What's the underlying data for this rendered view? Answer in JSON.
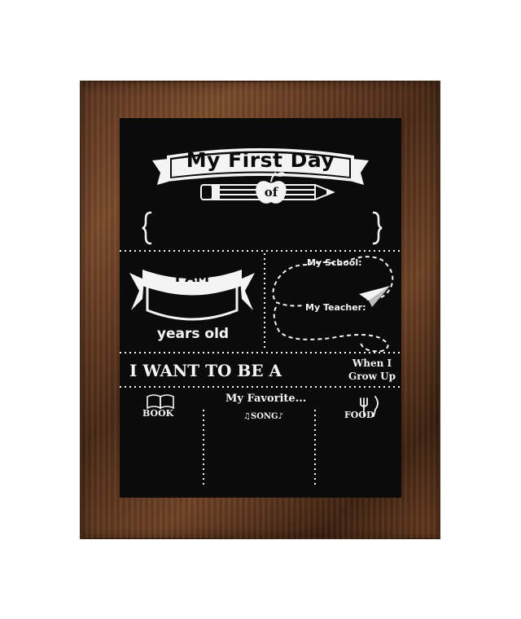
{
  "title": {
    "line1": "My First Day",
    "line2": "of"
  },
  "age_section": {
    "label_top": "I AM",
    "label_bottom": "years old"
  },
  "school_section": {
    "school_label": "My School:",
    "teacher_label": "My Teacher:"
  },
  "career_section": {
    "label": "I WANT TO BE A",
    "side_note_line1": "When I",
    "side_note_line2": "Grow Up"
  },
  "favorites_section": {
    "heading": "My Favorite...",
    "items": [
      {
        "label": "BOOK",
        "icon": "book-icon"
      },
      {
        "label": "SONG",
        "icon": "music-note-icon"
      },
      {
        "label": "FOOD",
        "icon": "fork-knife-icon"
      }
    ]
  },
  "colors": {
    "chalk": "#f4f4f4",
    "board": "#0b0b0b",
    "frame_wood": "#5a3520"
  }
}
